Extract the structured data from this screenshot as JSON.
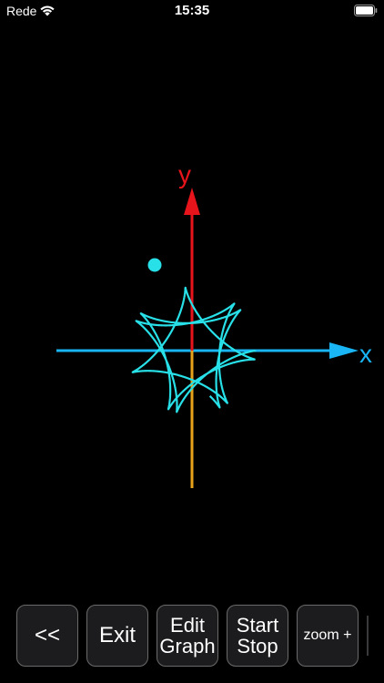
{
  "status": {
    "carrier": "Rede",
    "time": "15:35"
  },
  "graph": {
    "x_label": "x",
    "y_label": "y",
    "colors": {
      "curve": "#28e0e8",
      "x_axis": "#19b5f5",
      "y_axis_positive": "#e8141b",
      "y_axis_negative": "#e8a21a",
      "x_label": "#19b5f5",
      "y_label": "#e8141b"
    },
    "curve": "hypotrochoid-rosette",
    "tracer_point": "filled-circle"
  },
  "toolbar": {
    "back_label": "<<",
    "exit_label": "Exit",
    "edit_line1": "Edit",
    "edit_line2": "Graph",
    "start_line1": "Start",
    "start_line2": "Stop",
    "zoom_label": "zoom +"
  }
}
